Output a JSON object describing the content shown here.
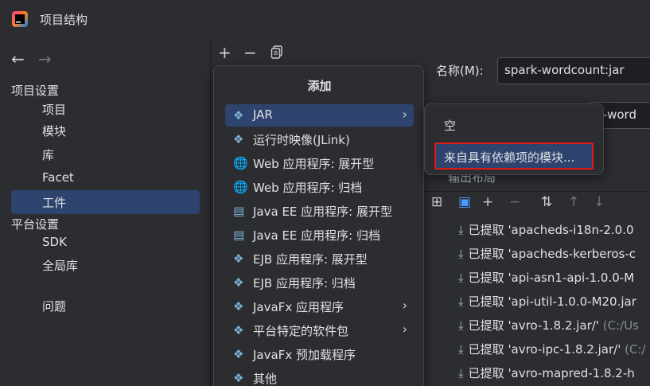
{
  "window": {
    "title": "项目结构"
  },
  "sidebar": {
    "project_settings_title": "项目设置",
    "project_items": [
      {
        "label": "项目"
      },
      {
        "label": "模块"
      },
      {
        "label": "库"
      },
      {
        "label": "Facet"
      },
      {
        "label": "工件",
        "selected": true
      }
    ],
    "platform_settings_title": "平台设置",
    "platform_items": [
      {
        "label": "SDK"
      },
      {
        "label": "全局库"
      }
    ],
    "problems": "问题"
  },
  "toolbar": {
    "add_icon": "+",
    "remove_icon": "−",
    "copy_icon": "copy-icon"
  },
  "artifact": {
    "name_label": "名称(M):",
    "name_value": "spark-wordcount:jar",
    "type_value_visible": "k-word",
    "output_layout_label": "输出布局"
  },
  "output_tree": {
    "rows": [
      {
        "prefix": "已提取",
        "name": "'apacheds-i18n-2.0.0",
        "path": ""
      },
      {
        "prefix": "已提取",
        "name": "'apacheds-kerberos-c",
        "path": ""
      },
      {
        "prefix": "已提取",
        "name": "'api-asn1-api-1.0.0-M",
        "path": ""
      },
      {
        "prefix": "已提取",
        "name": "'api-util-1.0.0-M20.jar",
        "path": ""
      },
      {
        "prefix": "已提取",
        "name": "'avro-1.8.2.jar/'",
        "path": "(C:/Us"
      },
      {
        "prefix": "已提取",
        "name": "'avro-ipc-1.8.2.jar/'",
        "path": "(C:/"
      },
      {
        "prefix": "已提取",
        "name": "'avro-mapred-1.8.2-h",
        "path": ""
      }
    ]
  },
  "add_popup": {
    "title": "添加",
    "items": [
      {
        "label": "JAR",
        "has_submenu": true,
        "selected": true
      },
      {
        "label": "运行时映像(JLink)"
      },
      {
        "label": "Web 应用程序: 展开型"
      },
      {
        "label": "Web 应用程序: 归档"
      },
      {
        "label": "Java EE 应用程序: 展开型"
      },
      {
        "label": "Java EE 应用程序: 归档"
      },
      {
        "label": "EJB 应用程序: 展开型"
      },
      {
        "label": "EJB 应用程序: 归档"
      },
      {
        "label": "JavaFx 应用程序",
        "has_submenu": true
      },
      {
        "label": "平台特定的软件包",
        "has_submenu": true
      },
      {
        "label": "JavaFx 预加载程序"
      },
      {
        "label": "其他"
      }
    ]
  },
  "jar_submenu": {
    "empty": "空",
    "from_modules": "来自具有依赖项的模块..."
  },
  "colors": {
    "background": "#2b2d30",
    "selection": "#2e436e",
    "highlight_border": "#e01b1b"
  }
}
